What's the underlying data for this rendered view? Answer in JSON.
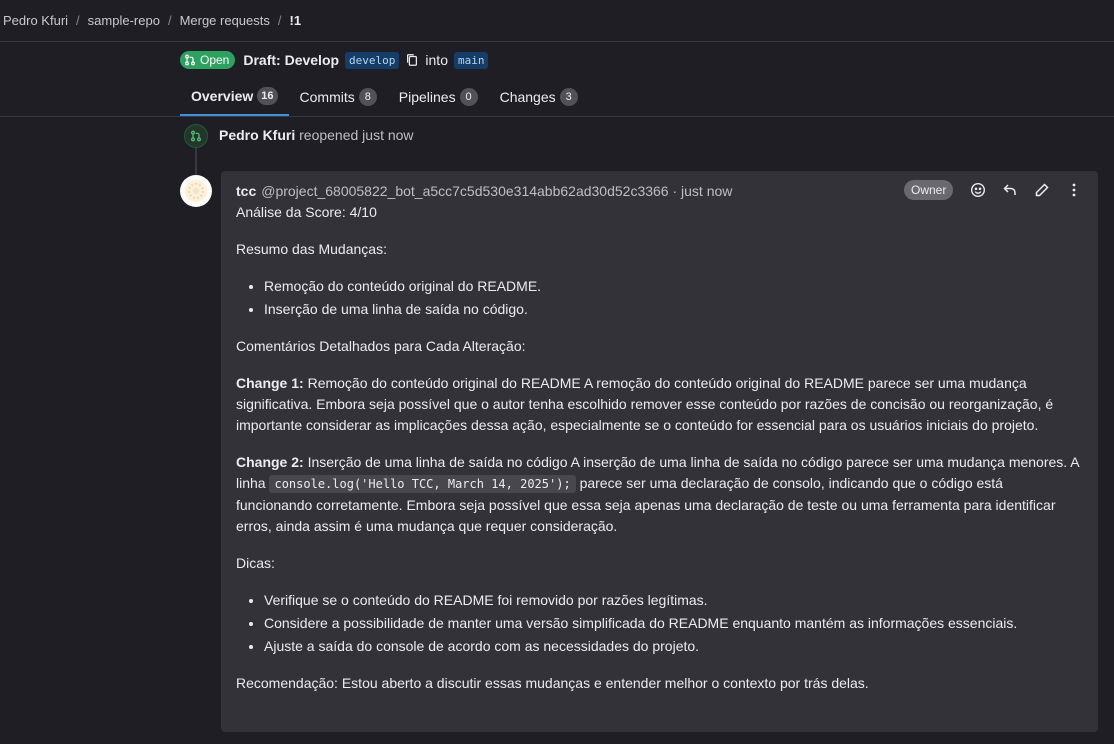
{
  "breadcrumb": [
    "Pedro Kfuri",
    "sample-repo",
    "Merge requests",
    "!1"
  ],
  "breadcrumb_sep": "/",
  "mr": {
    "status": "Open",
    "title": "Draft: Develop",
    "source_branch": "develop",
    "into": "into",
    "target_branch": "main"
  },
  "tabs": [
    {
      "label": "Overview",
      "count": "16"
    },
    {
      "label": "Commits",
      "count": "8"
    },
    {
      "label": "Pipelines",
      "count": "0"
    },
    {
      "label": "Changes",
      "count": "3"
    }
  ],
  "event": {
    "author": "Pedro Kfuri",
    "text": "reopened just now"
  },
  "note": {
    "author": "tcc",
    "handle": "@project_68005822_bot_a5cc7c5d530e314abb62ad30d52c3366 · just now",
    "role": "Owner",
    "score": "Análise da Score: 4/10",
    "summary_heading": "Resumo das Mudanças:",
    "summary_items": [
      "Remoção do conteúdo original do README.",
      "Inserção de uma linha de saída no código."
    ],
    "comments_heading": "Comentários Detalhados para Cada Alteração:",
    "change1_label": "Change 1:",
    "change1_text": " Remoção do conteúdo original do README A remoção do conteúdo original do README parece ser uma mudança significativa. Embora seja possível que o autor tenha escolhido remover esse conteúdo por razões de concisão ou reorganização, é importante considerar as implicações dessa ação, especialmente se o conteúdo for essencial para os usuários iniciais do projeto.",
    "change2_label": "Change 2:",
    "change2_text_a": " Inserção de uma linha de saída no código A inserção de uma linha de saída no código parece ser uma mudança menores. A linha ",
    "change2_code": "console.log('Hello TCC, March 14, 2025');",
    "change2_text_b": " parece ser uma declaração de consolo, indicando que o código está funcionando corretamente. Embora seja possível que essa seja apenas uma declaração de teste ou uma ferramenta para identificar erros, ainda assim é uma mudança que requer consideração.",
    "tips_heading": "Dicas:",
    "tips": [
      "Verifique se o conteúdo do README foi removido por razões legítimas.",
      "Considere a possibilidade de manter uma versão simplificada do README enquanto mantém as informações essenciais.",
      "Ajuste a saída do console de acordo com as necessidades do projeto."
    ],
    "recommendation": "Recomendação: Estou aberto a discutir essas mudanças e entender melhor o contexto por trás delas."
  },
  "icons": [
    "merge-request-icon",
    "copy-icon",
    "reopen-icon",
    "avatar-icon",
    "emoji-icon",
    "reply-icon",
    "edit-icon",
    "more-icon"
  ],
  "colors": {
    "background": "#1f1e24",
    "note_bg": "#333238",
    "status_green": "#2da160",
    "tab_accent": "#428fdc",
    "branch_bg": "#153d67"
  }
}
